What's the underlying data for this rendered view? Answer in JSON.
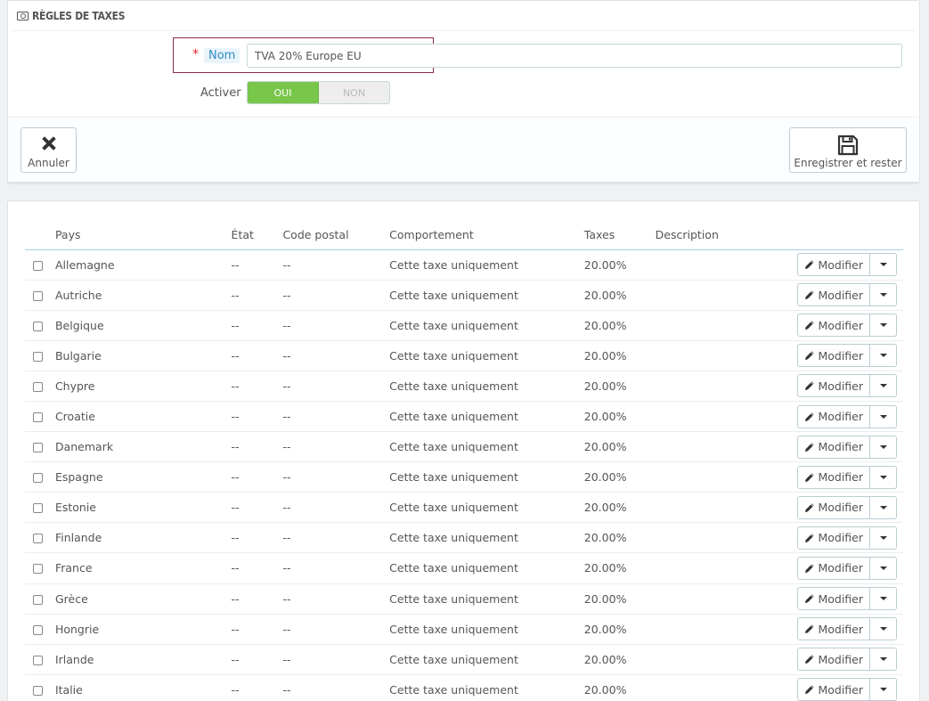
{
  "form": {
    "heading": "RÈGLES DE TAXES",
    "name_label": "Nom",
    "name_value": "TVA 20% Europe EU",
    "activate_label": "Activer",
    "switch_on": "OUI",
    "switch_off": "NON",
    "cancel_label": "Annuler",
    "save_label": "Enregistrer et rester"
  },
  "table": {
    "columns": [
      "Pays",
      "État",
      "Code postal",
      "Comportement",
      "Taxes",
      "Description"
    ],
    "edit_label": "Modifier",
    "rows": [
      {
        "country": "Allemagne",
        "state": "--",
        "zip": "--",
        "behavior": "Cette taxe uniquement",
        "tax": "20.00%",
        "description": ""
      },
      {
        "country": "Autriche",
        "state": "--",
        "zip": "--",
        "behavior": "Cette taxe uniquement",
        "tax": "20.00%",
        "description": ""
      },
      {
        "country": "Belgique",
        "state": "--",
        "zip": "--",
        "behavior": "Cette taxe uniquement",
        "tax": "20.00%",
        "description": ""
      },
      {
        "country": "Bulgarie",
        "state": "--",
        "zip": "--",
        "behavior": "Cette taxe uniquement",
        "tax": "20.00%",
        "description": ""
      },
      {
        "country": "Chypre",
        "state": "--",
        "zip": "--",
        "behavior": "Cette taxe uniquement",
        "tax": "20.00%",
        "description": ""
      },
      {
        "country": "Croatie",
        "state": "--",
        "zip": "--",
        "behavior": "Cette taxe uniquement",
        "tax": "20.00%",
        "description": ""
      },
      {
        "country": "Danemark",
        "state": "--",
        "zip": "--",
        "behavior": "Cette taxe uniquement",
        "tax": "20.00%",
        "description": ""
      },
      {
        "country": "Espagne",
        "state": "--",
        "zip": "--",
        "behavior": "Cette taxe uniquement",
        "tax": "20.00%",
        "description": ""
      },
      {
        "country": "Estonie",
        "state": "--",
        "zip": "--",
        "behavior": "Cette taxe uniquement",
        "tax": "20.00%",
        "description": ""
      },
      {
        "country": "Finlande",
        "state": "--",
        "zip": "--",
        "behavior": "Cette taxe uniquement",
        "tax": "20.00%",
        "description": ""
      },
      {
        "country": "France",
        "state": "--",
        "zip": "--",
        "behavior": "Cette taxe uniquement",
        "tax": "20.00%",
        "description": ""
      },
      {
        "country": "Grèce",
        "state": "--",
        "zip": "--",
        "behavior": "Cette taxe uniquement",
        "tax": "20.00%",
        "description": ""
      },
      {
        "country": "Hongrie",
        "state": "--",
        "zip": "--",
        "behavior": "Cette taxe uniquement",
        "tax": "20.00%",
        "description": ""
      },
      {
        "country": "Irlande",
        "state": "--",
        "zip": "--",
        "behavior": "Cette taxe uniquement",
        "tax": "20.00%",
        "description": ""
      },
      {
        "country": "Italie",
        "state": "--",
        "zip": "--",
        "behavior": "Cette taxe uniquement",
        "tax": "20.00%",
        "description": ""
      }
    ]
  }
}
